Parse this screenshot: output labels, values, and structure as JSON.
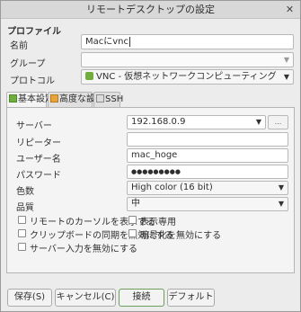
{
  "window": {
    "title": "リモートデスクトップの設定",
    "close_glyph": "✕"
  },
  "profile": {
    "section_title": "プロファイル",
    "name_label": "名前",
    "name_value": "Macにvnc",
    "group_label": "グループ",
    "group_value": "",
    "protocol_label": "プロトコル",
    "protocol_value": "VNC - 仮想ネットワークコンピューティング",
    "protocol_icon": "vnc-icon",
    "protocol_icon_color": "#6fae3c"
  },
  "tabs": [
    {
      "label": "基本設定",
      "icon": "basic-settings-icon",
      "color": "#6fae3c",
      "active": true
    },
    {
      "label": "高度な設定",
      "icon": "advanced-settings-icon",
      "color": "#e8a33a",
      "active": false
    },
    {
      "label": "SSH",
      "icon": "ssh-icon",
      "color": "#9a9a9a",
      "active": false
    }
  ],
  "basic": {
    "server_label": "サーバー",
    "server_value": "192.168.0.9",
    "server_browse": "...",
    "repeater_label": "リピーター",
    "repeater_value": "",
    "username_label": "ユーザー名",
    "username_value": "mac_hoge",
    "password_label": "パスワード",
    "password_value": "●●●●●●●●●",
    "colors_label": "色数",
    "colors_value": "High color (16 bit)",
    "quality_label": "品質",
    "quality_value": "中",
    "options": [
      {
        "label": "リモートのカーソルを表示する",
        "checked": false
      },
      {
        "label": "表示専用",
        "checked": false
      },
      {
        "label": "クリップボードの同期を無効にする",
        "checked": false
      },
      {
        "label": "暗号化を無効にする",
        "checked": false
      },
      {
        "label": "サーバー入力を無効にする",
        "checked": false
      }
    ]
  },
  "buttons": {
    "save": "保存(S)",
    "cancel": "キャンセル(C)",
    "connect": "接続",
    "default": "デフォルト"
  }
}
